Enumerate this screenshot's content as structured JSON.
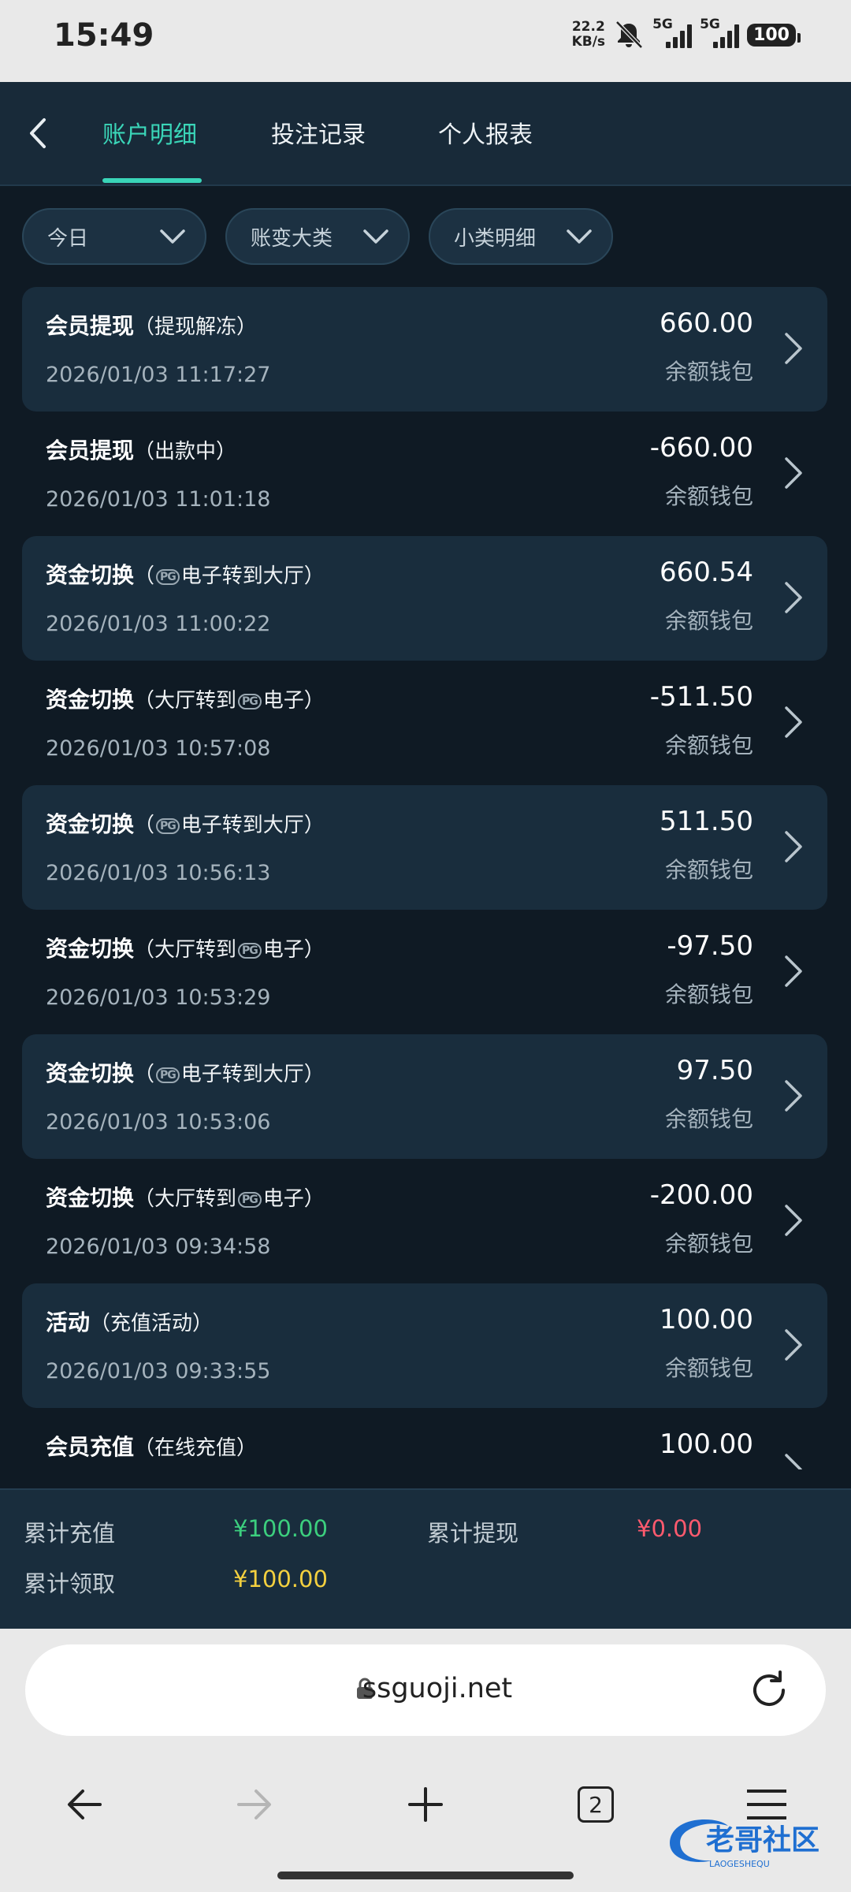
{
  "status_bar": {
    "time": "15:49",
    "net_speed_top": "22.2",
    "net_speed_bottom": "KB/s",
    "sig1": "5G",
    "sig2": "5G",
    "battery": "100"
  },
  "header": {
    "tabs": [
      {
        "label": "账户明细",
        "active": true
      },
      {
        "label": "投注记录",
        "active": false
      },
      {
        "label": "个人报表",
        "active": false
      }
    ]
  },
  "filters": [
    {
      "label": "今日"
    },
    {
      "label": "账变大类"
    },
    {
      "label": "小类明细"
    }
  ],
  "records": [
    {
      "title": "会员提现",
      "sub_pre": "（提现解冻）",
      "pg": "",
      "sub_post": "",
      "date": "2026/01/03 11:17:27",
      "amount": "660.00",
      "wallet": "余额钱包"
    },
    {
      "title": "会员提现",
      "sub_pre": "（出款中）",
      "pg": "",
      "sub_post": "",
      "date": "2026/01/03 11:01:18",
      "amount": "-660.00",
      "wallet": "余额钱包"
    },
    {
      "title": "资金切换",
      "sub_pre": "（",
      "pg": "PG",
      "sub_post": "电子转到大厅）",
      "date": "2026/01/03 11:00:22",
      "amount": "660.54",
      "wallet": "余额钱包"
    },
    {
      "title": "资金切换",
      "sub_pre": "（大厅转到",
      "pg": "PG",
      "sub_post": "电子）",
      "date": "2026/01/03 10:57:08",
      "amount": "-511.50",
      "wallet": "余额钱包"
    },
    {
      "title": "资金切换",
      "sub_pre": "（",
      "pg": "PG",
      "sub_post": "电子转到大厅）",
      "date": "2026/01/03 10:56:13",
      "amount": "511.50",
      "wallet": "余额钱包"
    },
    {
      "title": "资金切换",
      "sub_pre": "（大厅转到",
      "pg": "PG",
      "sub_post": "电子）",
      "date": "2026/01/03 10:53:29",
      "amount": "-97.50",
      "wallet": "余额钱包"
    },
    {
      "title": "资金切换",
      "sub_pre": "（",
      "pg": "PG",
      "sub_post": "电子转到大厅）",
      "date": "2026/01/03 10:53:06",
      "amount": "97.50",
      "wallet": "余额钱包"
    },
    {
      "title": "资金切换",
      "sub_pre": "（大厅转到",
      "pg": "PG",
      "sub_post": "电子）",
      "date": "2026/01/03 09:34:58",
      "amount": "-200.00",
      "wallet": "余额钱包"
    },
    {
      "title": "活动",
      "sub_pre": "（充值活动）",
      "pg": "",
      "sub_post": "",
      "date": "2026/01/03 09:33:55",
      "amount": "100.00",
      "wallet": "余额钱包"
    },
    {
      "title": "会员充值",
      "sub_pre": "（在线充值）",
      "pg": "",
      "sub_post": "",
      "date": "",
      "amount": "100.00",
      "wallet": ""
    }
  ],
  "summary": {
    "recharge_label": "累计充值",
    "recharge_value": "¥100.00",
    "withdraw_label": "累计提现",
    "withdraw_value": "¥0.00",
    "claim_label": "累计领取",
    "claim_value": "¥100.00"
  },
  "browser": {
    "url": "ssguoji.net",
    "tab_count": "2"
  },
  "watermark": {
    "text": "老哥社区",
    "sub": "LAOGESHEQU"
  },
  "colors": {
    "accent": "#3ad5b8",
    "recharge": "#3ccf7e",
    "withdraw": "#ff5a6e",
    "claim": "#f4d03f",
    "background": "#0f1a24",
    "row_shade": "#192d3d"
  }
}
